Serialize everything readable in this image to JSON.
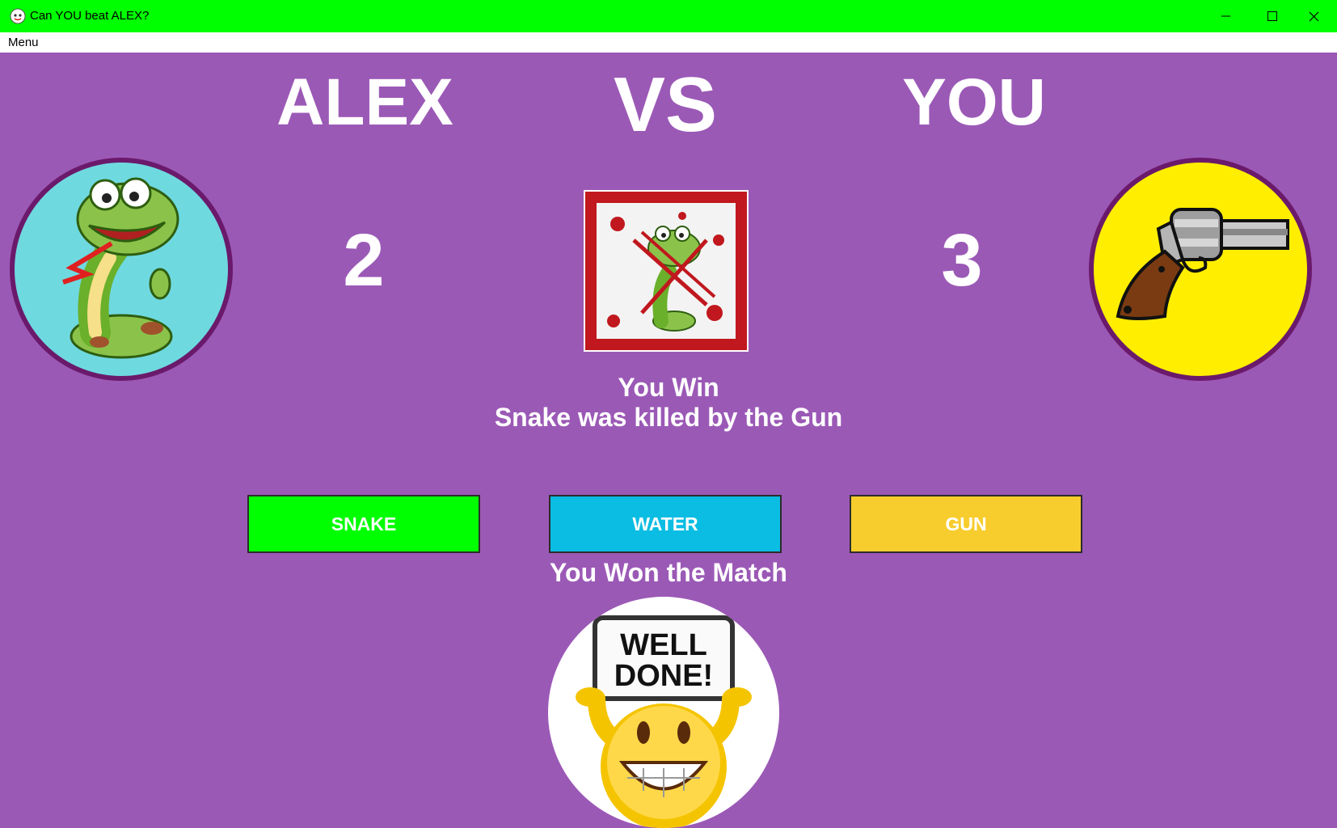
{
  "window": {
    "title": "Can YOU beat ALEX?",
    "icon": "app-logo-icon",
    "titlebar_color": "#00ff00"
  },
  "menu": {
    "items": [
      "Menu"
    ]
  },
  "header": {
    "left": "ALEX",
    "center": "VS",
    "right": "YOU"
  },
  "scores": {
    "alex": "2",
    "you": "3"
  },
  "choices": {
    "alex": "snake-icon",
    "you": "gun-icon",
    "result": "snake-killed-icon"
  },
  "result": {
    "line1": "You Win",
    "line2": "Snake was killed by the Gun"
  },
  "buttons": [
    {
      "label": "SNAKE",
      "color": "#00ff00"
    },
    {
      "label": "WATER",
      "color": "#0bbde3"
    },
    {
      "label": "GUN",
      "color": "#f7cd2e"
    }
  ],
  "match_result": "You Won the Match",
  "celebration": {
    "sign_line1": "WELL",
    "sign_line2": "DONE!"
  },
  "colors": {
    "background": "#9b59b6",
    "text": "#ffffff"
  }
}
